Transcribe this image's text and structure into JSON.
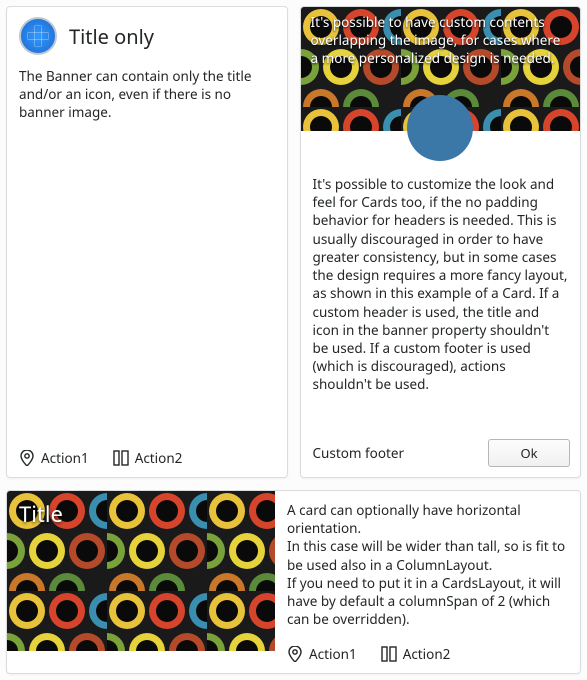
{
  "card1": {
    "title": "Title only",
    "body": "The Banner can contain only the title and/or an icon, even if there is no banner image.",
    "action1": "Action1",
    "action2": "Action2"
  },
  "card2": {
    "overlay": "It's possible to have custom contents overlapping the image, for cases where a more personalized design is needed.",
    "body": "It's possible to customize the look and feel for Cards too, if the no padding behavior for headers is needed. This is usually discouraged in order to have greater consistency, but in some cases the design requires a more fancy layout, as shown in this example of a Card. If a custom header is used, the title and icon in the banner property shouldn't be used. If a custom footer is used (which is discouraged), actions shouldn't be used.",
    "footerLabel": "Custom footer",
    "ok": "Ok"
  },
  "card3": {
    "title": "Title",
    "body": "A card can optionally have horizontal orientation.\n In this case will be wider than tall, so is fit to be used also in a ColumnLayout.\nIf you need to put it in a CardsLayout, it will have by default a columnSpan of 2 (which can be overridden).",
    "action1": "Action1",
    "action2": "Action2"
  }
}
